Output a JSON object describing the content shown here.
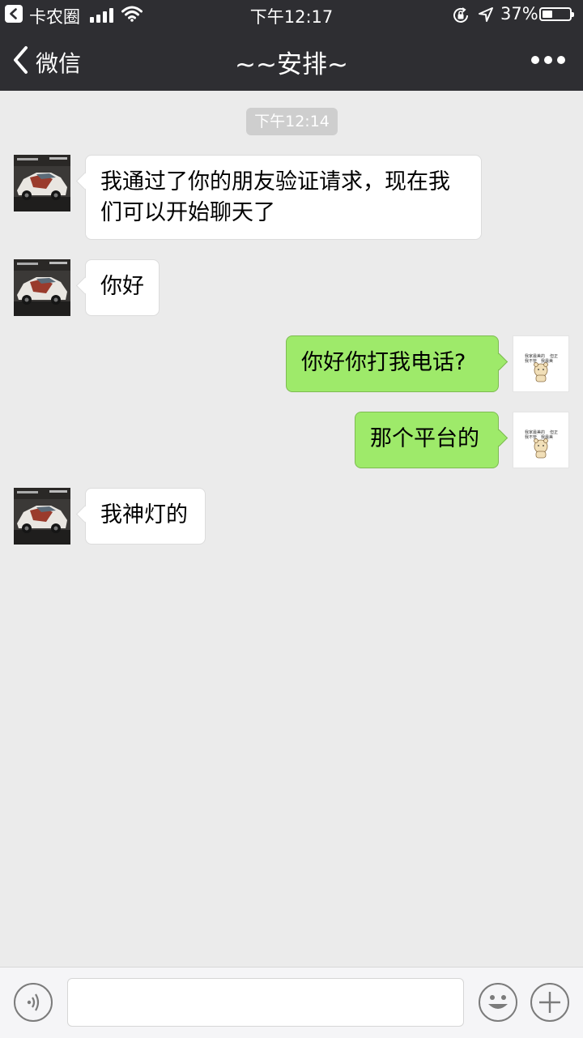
{
  "status_bar": {
    "back_app": "卡农圈",
    "time": "下午12:17",
    "battery_percent": "37%",
    "battery_level": 0.37,
    "icons": [
      "back-arrow-icon",
      "signal-icon",
      "wifi-icon",
      "orientation-lock-icon",
      "location-arrow-icon",
      "battery-icon"
    ]
  },
  "nav": {
    "back_label": "微信",
    "title": "~~安排~",
    "more_icon": "more-dots-icon"
  },
  "chat": {
    "timestamp": "下午12:14",
    "messages": [
      {
        "from": "contact",
        "text": "我通过了你的朋友验证请求，现在我们可以开始聊天了"
      },
      {
        "from": "contact",
        "text": "你好"
      },
      {
        "from": "me",
        "text": "你好你打我电话?"
      },
      {
        "from": "me",
        "text": "那个平台的"
      },
      {
        "from": "contact",
        "text": "我神灯的"
      }
    ],
    "my_avatar_text": [
      "我家最美的",
      "但正",
      "我不管",
      "我最美"
    ]
  },
  "input_bar": {
    "voice_icon": "voice-icon",
    "emoji_icon": "emoji-icon",
    "plus_icon": "plus-icon",
    "placeholder": ""
  },
  "colors": {
    "bar_bg": "#2e2e32",
    "chat_bg": "#ebebeb",
    "out_bubble": "#9eea6a",
    "in_bubble": "#ffffff"
  }
}
